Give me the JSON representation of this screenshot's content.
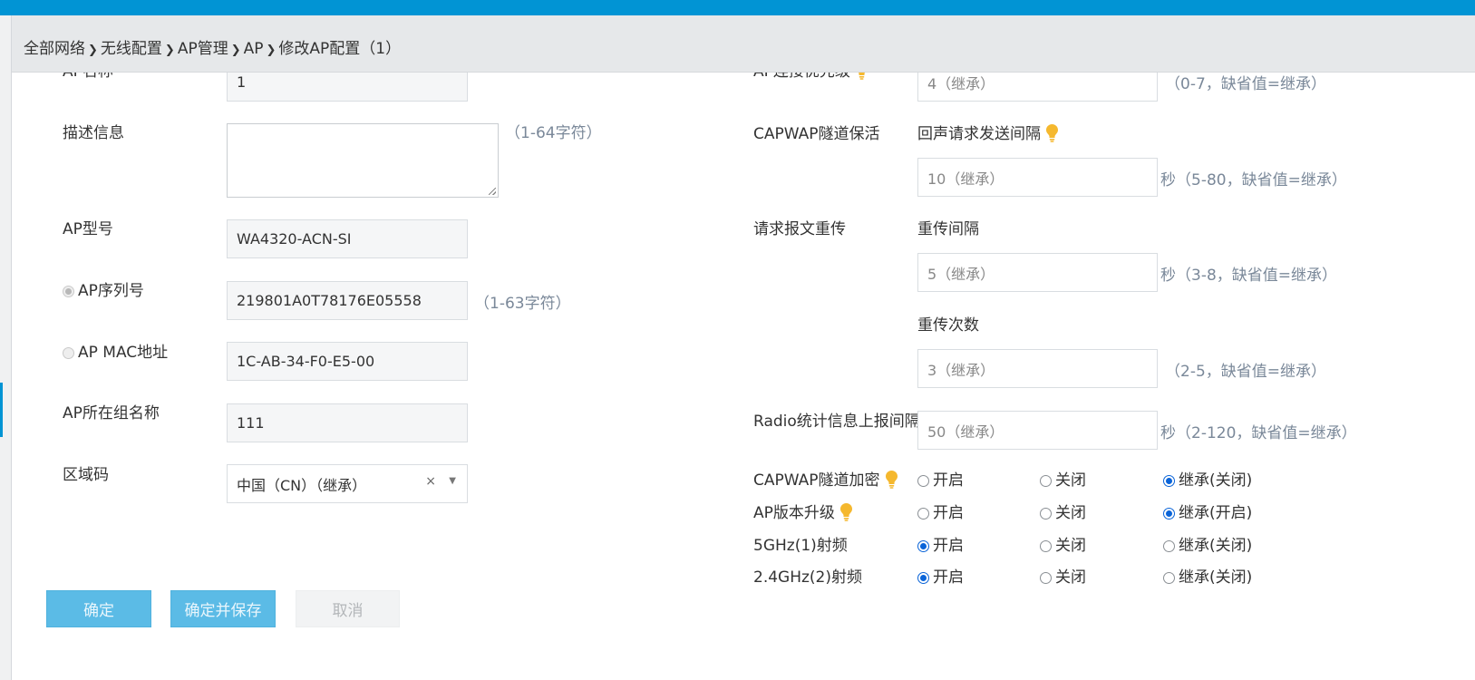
{
  "breadcrumb": [
    "全部网络",
    "无线配置",
    "AP管理",
    "AP",
    "修改AP配置（1）"
  ],
  "left": {
    "ap_name_label": "AP名称",
    "ap_name_value": "1",
    "desc_label": "描述信息",
    "desc_hint": "（1-64字符）",
    "model_label": "AP型号",
    "model_value": "WA4320-ACN-SI",
    "serial_label": "AP序列号",
    "serial_value": "219801A0T78176E05558",
    "serial_hint": "（1-63字符）",
    "mac_label": "AP MAC地址",
    "mac_value": "1C-AB-34-F0-E5-00",
    "group_label": "AP所在组名称",
    "group_value": "111",
    "region_label": "区域码",
    "region_value": "中国（CN）（继承）",
    "region_clear": "×",
    "region_caret": "▼"
  },
  "right": {
    "priority_label": "AP连接优先级",
    "priority_placeholder": "4（继承）",
    "priority_hint": "（0-7，缺省值=继承）",
    "keepalive_label": "CAPWAP隧道保活",
    "echo_label": "回声请求发送间隔",
    "echo_placeholder": "10（继承）",
    "echo_hint": "秒（5-80，缺省值=继承）",
    "retrans_label": "请求报文重传",
    "retrans_interval_label": "重传间隔",
    "retrans_interval_placeholder": "5（继承）",
    "retrans_interval_hint": "秒（3-8，缺省值=继承）",
    "retrans_count_label": "重传次数",
    "retrans_count_placeholder": "3（继承）",
    "retrans_count_hint": "（2-5，缺省值=继承）",
    "radio_stat_label": "Radio统计信息上报间隔",
    "radio_stat_placeholder": "50（继承）",
    "radio_stat_hint": "秒（2-120，缺省值=继承）",
    "options": [
      {
        "label": "CAPWAP隧道加密",
        "bulb": true,
        "choices": [
          "开启",
          "关闭",
          "继承(关闭)"
        ],
        "selected": 2
      },
      {
        "label": "AP版本升级",
        "bulb": true,
        "choices": [
          "开启",
          "关闭",
          "继承(开启)"
        ],
        "selected": 2
      },
      {
        "label": "5GHz(1)射频",
        "bulb": false,
        "choices": [
          "开启",
          "关闭",
          "继承(关闭)"
        ],
        "selected": 0
      },
      {
        "label": "2.4GHz(2)射频",
        "bulb": false,
        "choices": [
          "开启",
          "关闭",
          "继承(关闭)"
        ],
        "selected": 0
      }
    ]
  },
  "buttons": {
    "ok": "确定",
    "ok_save": "确定并保存",
    "cancel": "取消"
  },
  "colors": {
    "topbar": "#0194d4",
    "primary_button": "#5bbbe6",
    "bulb": "#f5b82e",
    "radio_selected": "#0a64d8"
  }
}
